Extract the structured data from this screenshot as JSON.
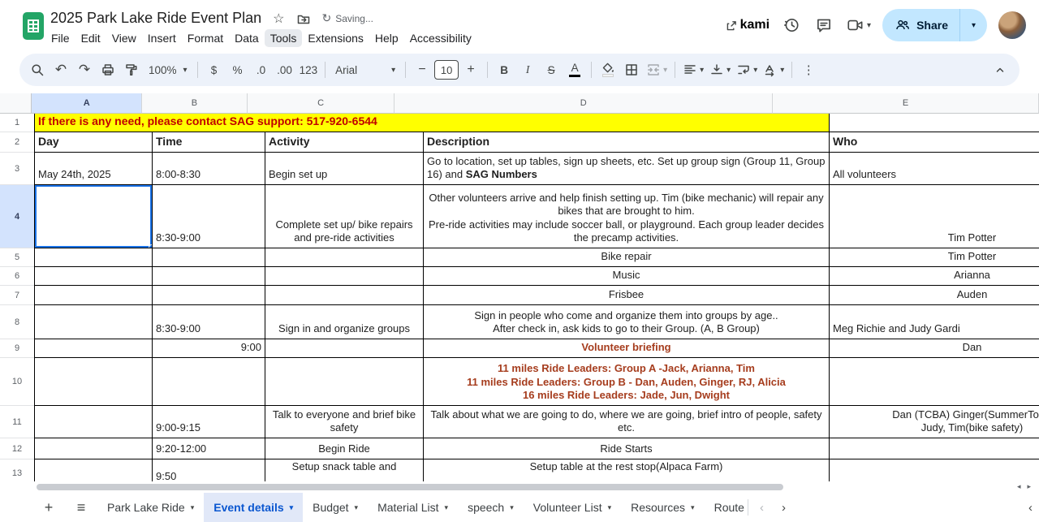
{
  "titlebar": {
    "title": "2025 Park Lake Ride Event Plan",
    "saving": "Saving...",
    "kami": "kami",
    "share": "Share",
    "menus": [
      "File",
      "Edit",
      "View",
      "Insert",
      "Format",
      "Data",
      "Tools",
      "Extensions",
      "Help",
      "Accessibility"
    ]
  },
  "toolbar": {
    "zoom": "100%",
    "currency": "$",
    "percent": "%",
    "dec_down": ".0",
    "dec_up": ".00",
    "num_format": "123",
    "font_name": "Arial",
    "font_size": "10",
    "bold": "B",
    "italic": "I",
    "strike": "S",
    "text_color": "A",
    "icons": [
      "search",
      "undo",
      "redo",
      "print",
      "paint-format",
      "fill-color",
      "borders",
      "merge-cells",
      "horizontal-align",
      "vertical-align",
      "text-wrap",
      "text-rotation",
      "more",
      "collapse-toolbar"
    ]
  },
  "grid": {
    "col_letters": [
      "A",
      "B",
      "C",
      "D",
      "E"
    ],
    "row_nums": [
      "1",
      "2",
      "3",
      "4",
      "5",
      "6",
      "7",
      "8",
      "9",
      "10",
      "11",
      "12",
      "13"
    ],
    "notice": "If there is any need, please contact SAG support: 517-920-6544",
    "headers": {
      "day": "Day",
      "time": "Time",
      "activity": "Activity",
      "description": "Description",
      "who": "Who"
    },
    "r3": {
      "day": "May 24th, 2025",
      "time": "8:00-8:30",
      "activity": "Begin set up",
      "description": "Go to location, set up tables, sign up sheets, etc. Set up group sign (Group 11, Group 16) and ",
      "description_bold": "SAG Numbers",
      "who": "All volunteers"
    },
    "r4": {
      "time": "8:30-9:00",
      "activity": "Complete set up/ bike repairs and pre-ride activities",
      "description": "Other volunteers arrive and help finish setting up. Tim (bike mechanic) will repair any bikes that are brought to him.\nPre-ride activities may include soccer ball, or playground. Each group leader decides the precamp activities.",
      "who": "Tim Potter"
    },
    "r5": {
      "description": "Bike repair",
      "who": "Tim Potter"
    },
    "r6": {
      "description": "Music",
      "who": "Arianna"
    },
    "r7": {
      "description": "Frisbee",
      "who": "Auden"
    },
    "r8": {
      "time": "8:30-9:00",
      "activity": "Sign in and organize groups",
      "description": "Sign in people who come and organize them into groups by age..\nAfter check in, ask kids to go to their Group. (A, B Group)",
      "who": "Meg Richie and Judy Gardi"
    },
    "r9": {
      "time": "9:00",
      "description": "Volunteer briefing",
      "who": "Dan"
    },
    "r10": {
      "description": "11 miles Ride Leaders: Group A -Jack, Arianna, Tim\n11 miles Ride Leaders: Group B - Dan, Auden, Ginger, RJ,  Alicia\n16 miles Ride Leaders: Jade, Jun, Dwight"
    },
    "r11": {
      "time": "9:00-9:15",
      "activity": "Talk to everyone and brief bike safety",
      "description": "Talk about what we are going to do, where we are going, brief intro of people, safety etc.",
      "who": "Dan (TCBA) Ginger(SummerTour)\nJudy, Tim(bike safety)"
    },
    "r12": {
      "time": "9:20-12:00",
      "activity": "Begin Ride",
      "description": "Ride Starts"
    },
    "r13": {
      "time": "9:50",
      "activity": "Setup snack table and",
      "description": "Setup table at the rest stop(Alpaca Farm)"
    }
  },
  "tabs": {
    "items": [
      {
        "name": "Park Lake Ride"
      },
      {
        "name": "Event details"
      },
      {
        "name": "Budget"
      },
      {
        "name": "Material List"
      },
      {
        "name": "speech"
      },
      {
        "name": "Volunteer List"
      },
      {
        "name": "Resources"
      },
      {
        "name": "Route"
      }
    ],
    "active": "Event details"
  },
  "colors": {
    "accent_blue": "#0b57d0",
    "selection": "#1a73e8",
    "notice_bg": "#ffff00",
    "notice_text": "#c00000",
    "emphasis_text": "#a63d1e",
    "share_bg": "#c2e7ff"
  }
}
